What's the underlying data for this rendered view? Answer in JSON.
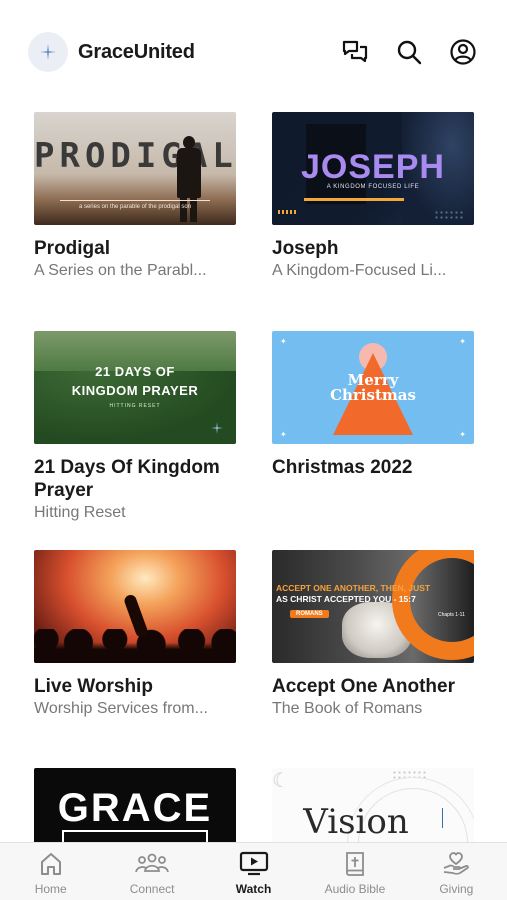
{
  "app": {
    "title": "GraceUnited"
  },
  "header": {
    "icons": [
      "chat-icon",
      "search-icon",
      "profile-icon"
    ]
  },
  "series": [
    {
      "title": "Prodigal",
      "subtitle": "A Series on the Parabl...",
      "thumb_text": "PRODIGAL",
      "thumb_caption": "a series on the parable of the prodigal son"
    },
    {
      "title": "Joseph",
      "subtitle": "A Kingdom-Focused Li...",
      "thumb_text": "JOSEPH",
      "thumb_caption": "A KINGDOM FOCUSED LIFE"
    },
    {
      "title": "21 Days Of Kingdom Prayer",
      "subtitle": "Hitting Reset",
      "thumb_text_1": "21 DAYS OF",
      "thumb_text_2": "KINGDOM PRAYER",
      "thumb_caption": "HITTING RESET"
    },
    {
      "title": "Christmas 2022",
      "subtitle": "",
      "thumb_text_1": "Merry",
      "thumb_text_2": "Christmas"
    },
    {
      "title": "Live Worship",
      "subtitle": "Worship Services from..."
    },
    {
      "title": "Accept One Another",
      "subtitle": "The Book of Romans",
      "thumb_text_1": "ACCEPT ONE ANOTHER, THEN, JUST",
      "thumb_text_2": "AS CHRIST ACCEPTED YOU - 15:7",
      "thumb_tag": "ROMANS",
      "thumb_note": "Chapts 1-11"
    },
    {
      "thumb_text": "GRACE"
    },
    {
      "thumb_text": "Vision"
    }
  ],
  "tabs": [
    {
      "label": "Home",
      "icon": "home-icon"
    },
    {
      "label": "Connect",
      "icon": "people-icon"
    },
    {
      "label": "Watch",
      "icon": "play-screen-icon",
      "active": true
    },
    {
      "label": "Audio Bible",
      "icon": "bible-icon"
    },
    {
      "label": "Giving",
      "icon": "giving-icon"
    }
  ],
  "colors": {
    "accent": "#1a1a1a",
    "muted": "#777777",
    "joseph_purple": "#a98bf0",
    "christmas_orange": "#f26a2b",
    "christmas_blue": "#74bdf0"
  }
}
